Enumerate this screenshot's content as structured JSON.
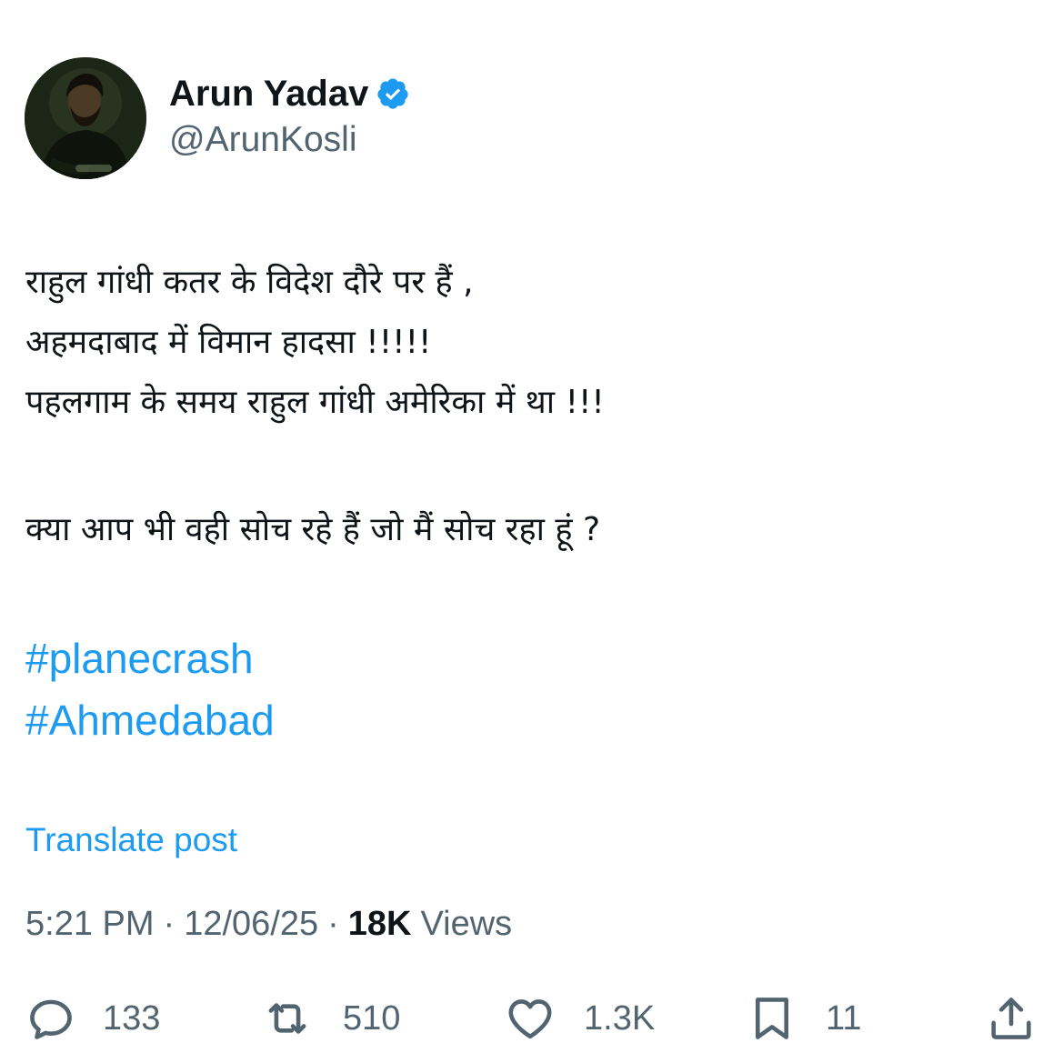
{
  "author": {
    "display_name": "Arun Yadav",
    "handle": "@ArunKosli",
    "verified": true,
    "avatar_icon": "profile-photo"
  },
  "tweet": {
    "lines": [
      "राहुल गांधी कतर के विदेश दौरे पर हैं ,",
      "अहमदाबाद में विमान हादसा !!!!!",
      "पहलगाम के समय राहुल गांधी अमेरिका में था !!!",
      "क्या आप भी वही सोच रहे हैं जो मैं सोच रहा हूं ?"
    ],
    "hashtags": [
      "#planecrash",
      "#Ahmedabad"
    ]
  },
  "translate_label": "Translate post",
  "meta": {
    "time": "5:21 PM",
    "separator": "·",
    "date": "12/06/25",
    "views_count": "18K",
    "views_label": "Views"
  },
  "actions": {
    "reply": {
      "icon": "reply-icon",
      "count": "133"
    },
    "retweet": {
      "icon": "retweet-icon",
      "count": "510"
    },
    "like": {
      "icon": "heart-icon",
      "count": "1.3K"
    },
    "bookmark": {
      "icon": "bookmark-icon",
      "count": "11"
    },
    "share": {
      "icon": "share-icon"
    }
  },
  "colors": {
    "link": "#1d9bf0",
    "muted": "#536471",
    "text": "#0f1419",
    "verified_badge": "#1d9bf0"
  }
}
